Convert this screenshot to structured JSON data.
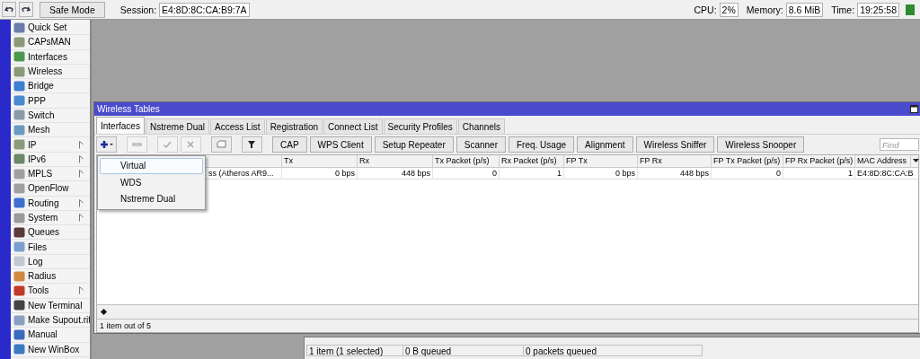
{
  "topbar": {
    "safe_mode": "Safe Mode",
    "session_label": "Session:",
    "session": "E4:8D:8C:CA:B9:7A",
    "stats": [
      {
        "label": "CPU:",
        "value": "2%"
      },
      {
        "label": "Memory:",
        "value": "8.6 MiB"
      },
      {
        "label": "Time:",
        "value": "19:25:58"
      }
    ]
  },
  "sidebar": {
    "items": [
      {
        "label": "Quick Set",
        "submenu": false
      },
      {
        "label": "CAPsMAN",
        "submenu": false
      },
      {
        "label": "Interfaces",
        "submenu": false
      },
      {
        "label": "Wireless",
        "submenu": false
      },
      {
        "label": "Bridge",
        "submenu": false
      },
      {
        "label": "PPP",
        "submenu": false
      },
      {
        "label": "Switch",
        "submenu": false
      },
      {
        "label": "Mesh",
        "submenu": false
      },
      {
        "label": "IP",
        "submenu": true
      },
      {
        "label": "IPv6",
        "submenu": true
      },
      {
        "label": "MPLS",
        "submenu": true
      },
      {
        "label": "OpenFlow",
        "submenu": false
      },
      {
        "label": "Routing",
        "submenu": true
      },
      {
        "label": "System",
        "submenu": true
      },
      {
        "label": "Queues",
        "submenu": false
      },
      {
        "label": "Files",
        "submenu": false
      },
      {
        "label": "Log",
        "submenu": false
      },
      {
        "label": "Radius",
        "submenu": false
      },
      {
        "label": "Tools",
        "submenu": true
      },
      {
        "label": "New Terminal",
        "submenu": false
      },
      {
        "label": "Make Supout.rif",
        "submenu": false
      },
      {
        "label": "Manual",
        "submenu": false
      },
      {
        "label": "New WinBox",
        "submenu": false
      }
    ]
  },
  "window": {
    "title": "Wireless Tables",
    "tabs": [
      {
        "label": "Interfaces",
        "selected": true
      },
      {
        "label": "Nstreme Dual",
        "selected": false
      },
      {
        "label": "Access List",
        "selected": false
      },
      {
        "label": "Registration",
        "selected": false
      },
      {
        "label": "Connect List",
        "selected": false
      },
      {
        "label": "Security Profiles",
        "selected": false
      },
      {
        "label": "Channels",
        "selected": false
      }
    ],
    "icon_buttons": [
      {
        "kind": "add",
        "disabled": false
      },
      {
        "kind": "remove",
        "disabled": true
      },
      {
        "kind": "enable",
        "disabled": true
      },
      {
        "kind": "disable",
        "disabled": true
      },
      {
        "kind": "comment",
        "disabled": false
      },
      {
        "kind": "filter",
        "disabled": false
      }
    ],
    "buttons": [
      "CAP",
      "WPS Client",
      "Setup Repeater",
      "Scanner",
      "Freq. Usage",
      "Alignment",
      "Wireless Sniffer",
      "Wireless Snooper"
    ],
    "search": {
      "placeholder": "Find"
    },
    "add_menu": [
      {
        "label": "Virtual",
        "selected": true
      },
      {
        "label": "WDS",
        "selected": false
      },
      {
        "label": "Nstreme Dual",
        "selected": false
      }
    ],
    "table": {
      "columns": [
        "",
        "Tx",
        "Rx",
        "Tx Packet (p/s)",
        "Rx Packet (p/s)",
        "FP Tx",
        "FP Rx",
        "FP Tx Packet (p/s)",
        "FP Rx Packet (p/s)",
        "MAC Address"
      ],
      "rows": [
        {
          "cells": [
            "ss (Atheros AR9...",
            "0 bps",
            "448 bps",
            "0",
            "1",
            "0 bps",
            "448 bps",
            "0",
            "1",
            "E4:8D:8C:CA:B"
          ]
        }
      ]
    },
    "status": "1 item out of 5"
  },
  "queue_window": {
    "status": [
      "1 item (1 selected)",
      "0 B queued",
      "0 packets queued"
    ]
  }
}
